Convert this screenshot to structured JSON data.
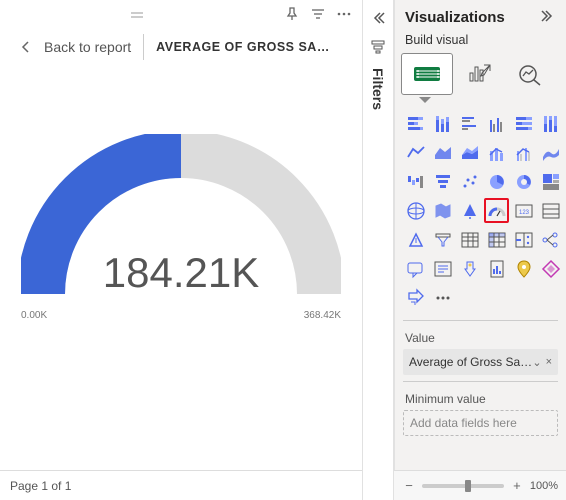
{
  "header": {
    "back_label": "Back to report",
    "page_title": "AVERAGE OF GROSS SAL..."
  },
  "chart_data": {
    "type": "gauge",
    "value": 184.21,
    "min": 0.0,
    "max": 368.42,
    "unit": "K",
    "center_label": "184.21K",
    "min_label": "0.00K",
    "max_label": "368.42K",
    "fill_color": "#3b66d6",
    "track_color": "#dcdcdc"
  },
  "pager": {
    "text": "Page 1 of 1"
  },
  "filters": {
    "title": "Filters"
  },
  "viz": {
    "title": "Visualizations",
    "subtitle": "Build visual",
    "modes": [
      "build-visual",
      "format-visual",
      "analytics"
    ],
    "items": [
      {
        "name": "stacked-bar"
      },
      {
        "name": "stacked-column"
      },
      {
        "name": "clustered-bar"
      },
      {
        "name": "clustered-column"
      },
      {
        "name": "100-stacked-bar"
      },
      {
        "name": "100-stacked-column"
      },
      {
        "name": "line"
      },
      {
        "name": "area"
      },
      {
        "name": "stacked-area"
      },
      {
        "name": "line-stacked-column"
      },
      {
        "name": "line-clustered-column"
      },
      {
        "name": "ribbon"
      },
      {
        "name": "waterfall"
      },
      {
        "name": "funnel"
      },
      {
        "name": "scatter"
      },
      {
        "name": "pie"
      },
      {
        "name": "donut"
      },
      {
        "name": "treemap"
      },
      {
        "name": "map"
      },
      {
        "name": "filled-map"
      },
      {
        "name": "azure-map"
      },
      {
        "name": "gauge",
        "highlight": true
      },
      {
        "name": "card"
      },
      {
        "name": "multi-row-card"
      },
      {
        "name": "kpi"
      },
      {
        "name": "slicer"
      },
      {
        "name": "table"
      },
      {
        "name": "matrix"
      },
      {
        "name": "r-visual"
      },
      {
        "name": "decomposition-tree"
      },
      {
        "name": "qa"
      },
      {
        "name": "smart-narrative"
      },
      {
        "name": "key-influencers"
      },
      {
        "name": "paginated-report"
      },
      {
        "name": "arcgis-map"
      },
      {
        "name": "power-apps"
      },
      {
        "name": "power-automate"
      },
      {
        "name": "more"
      }
    ],
    "field_section_1": "Value",
    "field_value_1": "Average of Gross Sales",
    "field_section_2": "Minimum value",
    "drop_placeholder": "Add data fields here"
  },
  "zoom": {
    "min_pct": 0,
    "max_pct": 100,
    "current_pct": 53,
    "label": "100%"
  }
}
